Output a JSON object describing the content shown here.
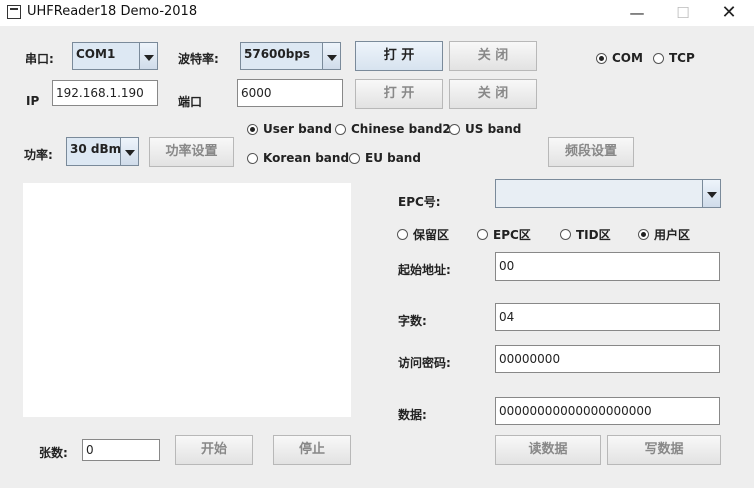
{
  "window": {
    "title": "UHFReader18 Demo-2018"
  },
  "serial": {
    "port_label": "串口:",
    "port_value": "COM1",
    "baud_label": "波特率:",
    "baud_value": "57600bps",
    "open_button": "打 开",
    "close_button": "关 闭"
  },
  "mode": {
    "com_label": "COM",
    "tcp_label": "TCP",
    "selected": "COM"
  },
  "network": {
    "ip_label": "IP",
    "ip_value": "192.168.1.190",
    "port_label": "端口",
    "port_value": "6000",
    "open_button": "打 开",
    "close_button": "关 闭"
  },
  "power": {
    "label": "功率:",
    "value": "30 dBm",
    "set_button": "功率设置"
  },
  "bands": {
    "user": "User band",
    "chinese2": "Chinese band2",
    "us": "US band",
    "korean": "Korean band",
    "eu": "EU band",
    "selected": "User band",
    "set_button": "频段设置"
  },
  "epc": {
    "label": "EPC号:",
    "value": ""
  },
  "memory": {
    "reserved": "保留区",
    "epc": "EPC区",
    "tid": "TID区",
    "user": "用户区",
    "selected": "用户区"
  },
  "fields": {
    "start_label": "起始地址:",
    "start_value": "00",
    "count_label": "字数:",
    "count_value": "04",
    "password_label": "访问密码:",
    "password_value": "00000000",
    "data_label": "数据:",
    "data_value": "00000000000000000000"
  },
  "inventory": {
    "count_label": "张数:",
    "count_value": "0",
    "start_button": "开始",
    "stop_button": "停止"
  },
  "actions": {
    "read_button": "读数据",
    "write_button": "写数据"
  }
}
